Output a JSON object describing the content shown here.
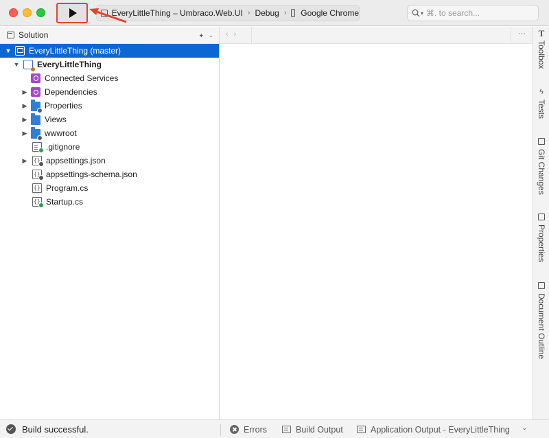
{
  "toolbar": {
    "config_project": "EveryLittleThing – Umbraco.Web.UI",
    "config_mode": "Debug",
    "config_target": "Google Chrome",
    "search_placeholder": "⌘. to search..."
  },
  "solution_pane": {
    "title": "Solution",
    "root_label": "EveryLittleThing (master)",
    "project_label": "EveryLittleThing",
    "items": [
      {
        "label": "Connected Services",
        "icon": "connected-services-icon",
        "expandable": false
      },
      {
        "label": "Dependencies",
        "icon": "dependencies-icon",
        "expandable": true
      },
      {
        "label": "Properties",
        "icon": "folder-icon",
        "expandable": true
      },
      {
        "label": "Views",
        "icon": "folder-icon",
        "expandable": true
      },
      {
        "label": "wwwroot",
        "icon": "folder-icon",
        "expandable": true
      },
      {
        "label": ".gitignore",
        "icon": "file-icon",
        "expandable": false
      },
      {
        "label": "appsettings.json",
        "icon": "json-file-icon",
        "expandable": true
      },
      {
        "label": "appsettings-schema.json",
        "icon": "json-file-icon",
        "expandable": false
      },
      {
        "label": "Program.cs",
        "icon": "cs-file-icon",
        "expandable": false
      },
      {
        "label": "Startup.cs",
        "icon": "cs-file-icon",
        "expandable": false
      }
    ]
  },
  "right_sidebar": {
    "tabs": [
      "Toolbox",
      "Tests",
      "Git Changes",
      "Properties",
      "Document Outline"
    ]
  },
  "status_bar": {
    "message": "Build successful.",
    "errors_label": "Errors",
    "build_output_label": "Build Output",
    "app_output_label": "Application Output - EveryLittleThing"
  },
  "colors": {
    "selection": "#0a67d4",
    "highlight_box": "#e8412c",
    "folder": "#2f7fd6",
    "purple_item": "#a448c8"
  }
}
